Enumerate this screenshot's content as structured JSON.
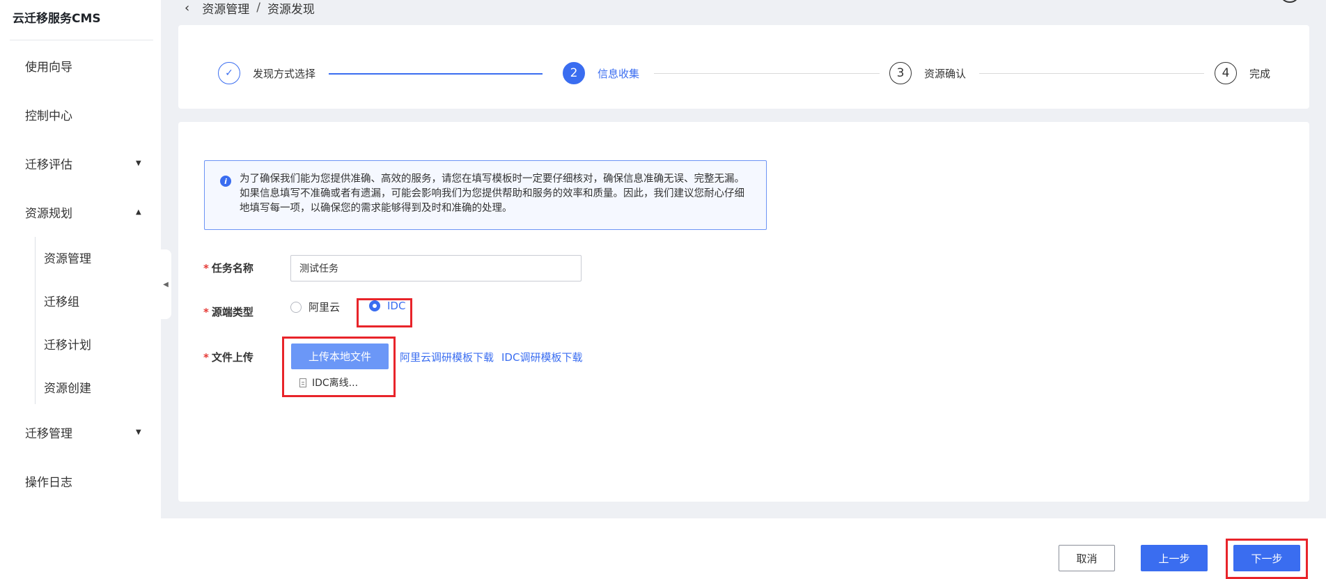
{
  "app": {
    "title": "云迁移服务CMS"
  },
  "sidebar": {
    "items": [
      {
        "label": "使用向导"
      },
      {
        "label": "控制中心"
      },
      {
        "label": "迁移评估",
        "caret": "▼"
      },
      {
        "label": "资源规划",
        "caret": "▲"
      },
      {
        "label": "迁移管理",
        "caret": "▼"
      },
      {
        "label": "操作日志"
      }
    ],
    "subitems": [
      {
        "label": "资源管理"
      },
      {
        "label": "迁移组"
      },
      {
        "label": "迁移计划"
      },
      {
        "label": "资源创建"
      }
    ],
    "collapse_icon": "◀"
  },
  "breadcrumb": {
    "back_icon": "‹",
    "parent": "资源管理",
    "separator": "/",
    "current": "资源发现"
  },
  "steps": [
    {
      "number": "✓",
      "label": "发现方式选择",
      "status": "done"
    },
    {
      "number": "2",
      "label": "信息收集",
      "status": "active"
    },
    {
      "number": "3",
      "label": "资源确认",
      "status": "pending"
    },
    {
      "number": "4",
      "label": "完成",
      "status": "pending"
    }
  ],
  "notice": {
    "icon": "i",
    "text": "为了确保我们能为您提供准确、高效的服务，请您在填写模板时一定要仔细核对，确保信息准确无误、完整无漏。如果信息填写不准确或者有遗漏，可能会影响我们为您提供帮助和服务的效率和质量。因此，我们建议您耐心仔细地填写每一项，以确保您的需求能够得到及时和准确的处理。"
  },
  "form": {
    "required_mark": "*",
    "task_name": {
      "label": "任务名称",
      "value": "测试任务"
    },
    "source_type": {
      "label": "源端类型",
      "options": [
        {
          "label": "阿里云",
          "checked": false
        },
        {
          "label": "IDC",
          "checked": true
        }
      ]
    },
    "file_upload": {
      "label": "文件上传",
      "button": "上传本地文件",
      "link_aliyun": "阿里云调研模板下载",
      "link_idc": "IDC调研模板下载",
      "file_name": "IDC离线..."
    }
  },
  "footer": {
    "cancel": "取消",
    "prev": "上一步",
    "next": "下一步"
  },
  "colors": {
    "primary": "#3a6df0",
    "highlight": "#e8242a",
    "required": "#e53935"
  }
}
